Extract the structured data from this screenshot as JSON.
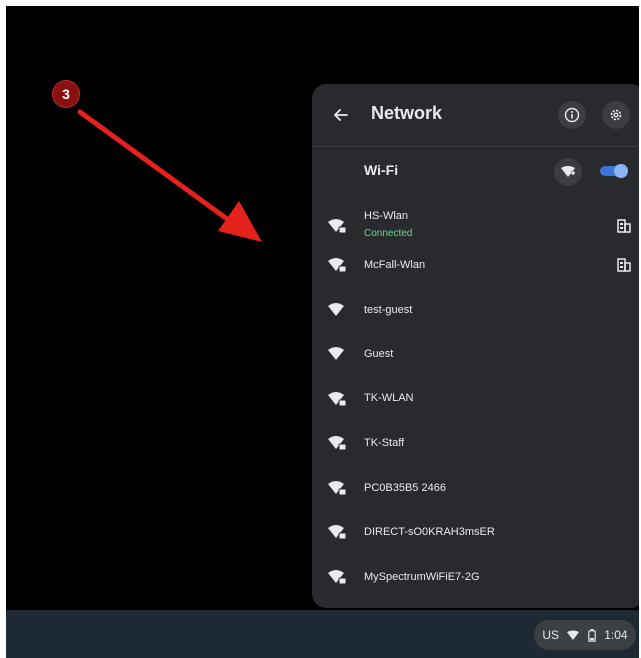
{
  "annotation": {
    "step": "3"
  },
  "panel": {
    "title": "Network",
    "wifi_label": "Wi-Fi",
    "wifi_enabled": true,
    "networks": [
      {
        "name": "HS-Wlan",
        "status": "Connected",
        "secured": true,
        "enterprise": true
      },
      {
        "name": "McFall-Wlan",
        "secured": true,
        "enterprise": true
      },
      {
        "name": "test-guest",
        "secured": false
      },
      {
        "name": "Guest",
        "secured": false
      },
      {
        "name": "TK-WLAN",
        "secured": true
      },
      {
        "name": "TK-Staff",
        "secured": true
      },
      {
        "name": "PC0B35B5 2466",
        "secured": true
      },
      {
        "name": "DIRECT-sO0KRAH3msER",
        "secured": true
      },
      {
        "name": "MySpectrumWiFiE7-2G",
        "secured": true
      }
    ]
  },
  "tray": {
    "input": "US",
    "time": "1:04"
  },
  "colors": {
    "accent": "#8ab4f8",
    "connected": "#6dd58c",
    "annotation": "#e5211b"
  }
}
